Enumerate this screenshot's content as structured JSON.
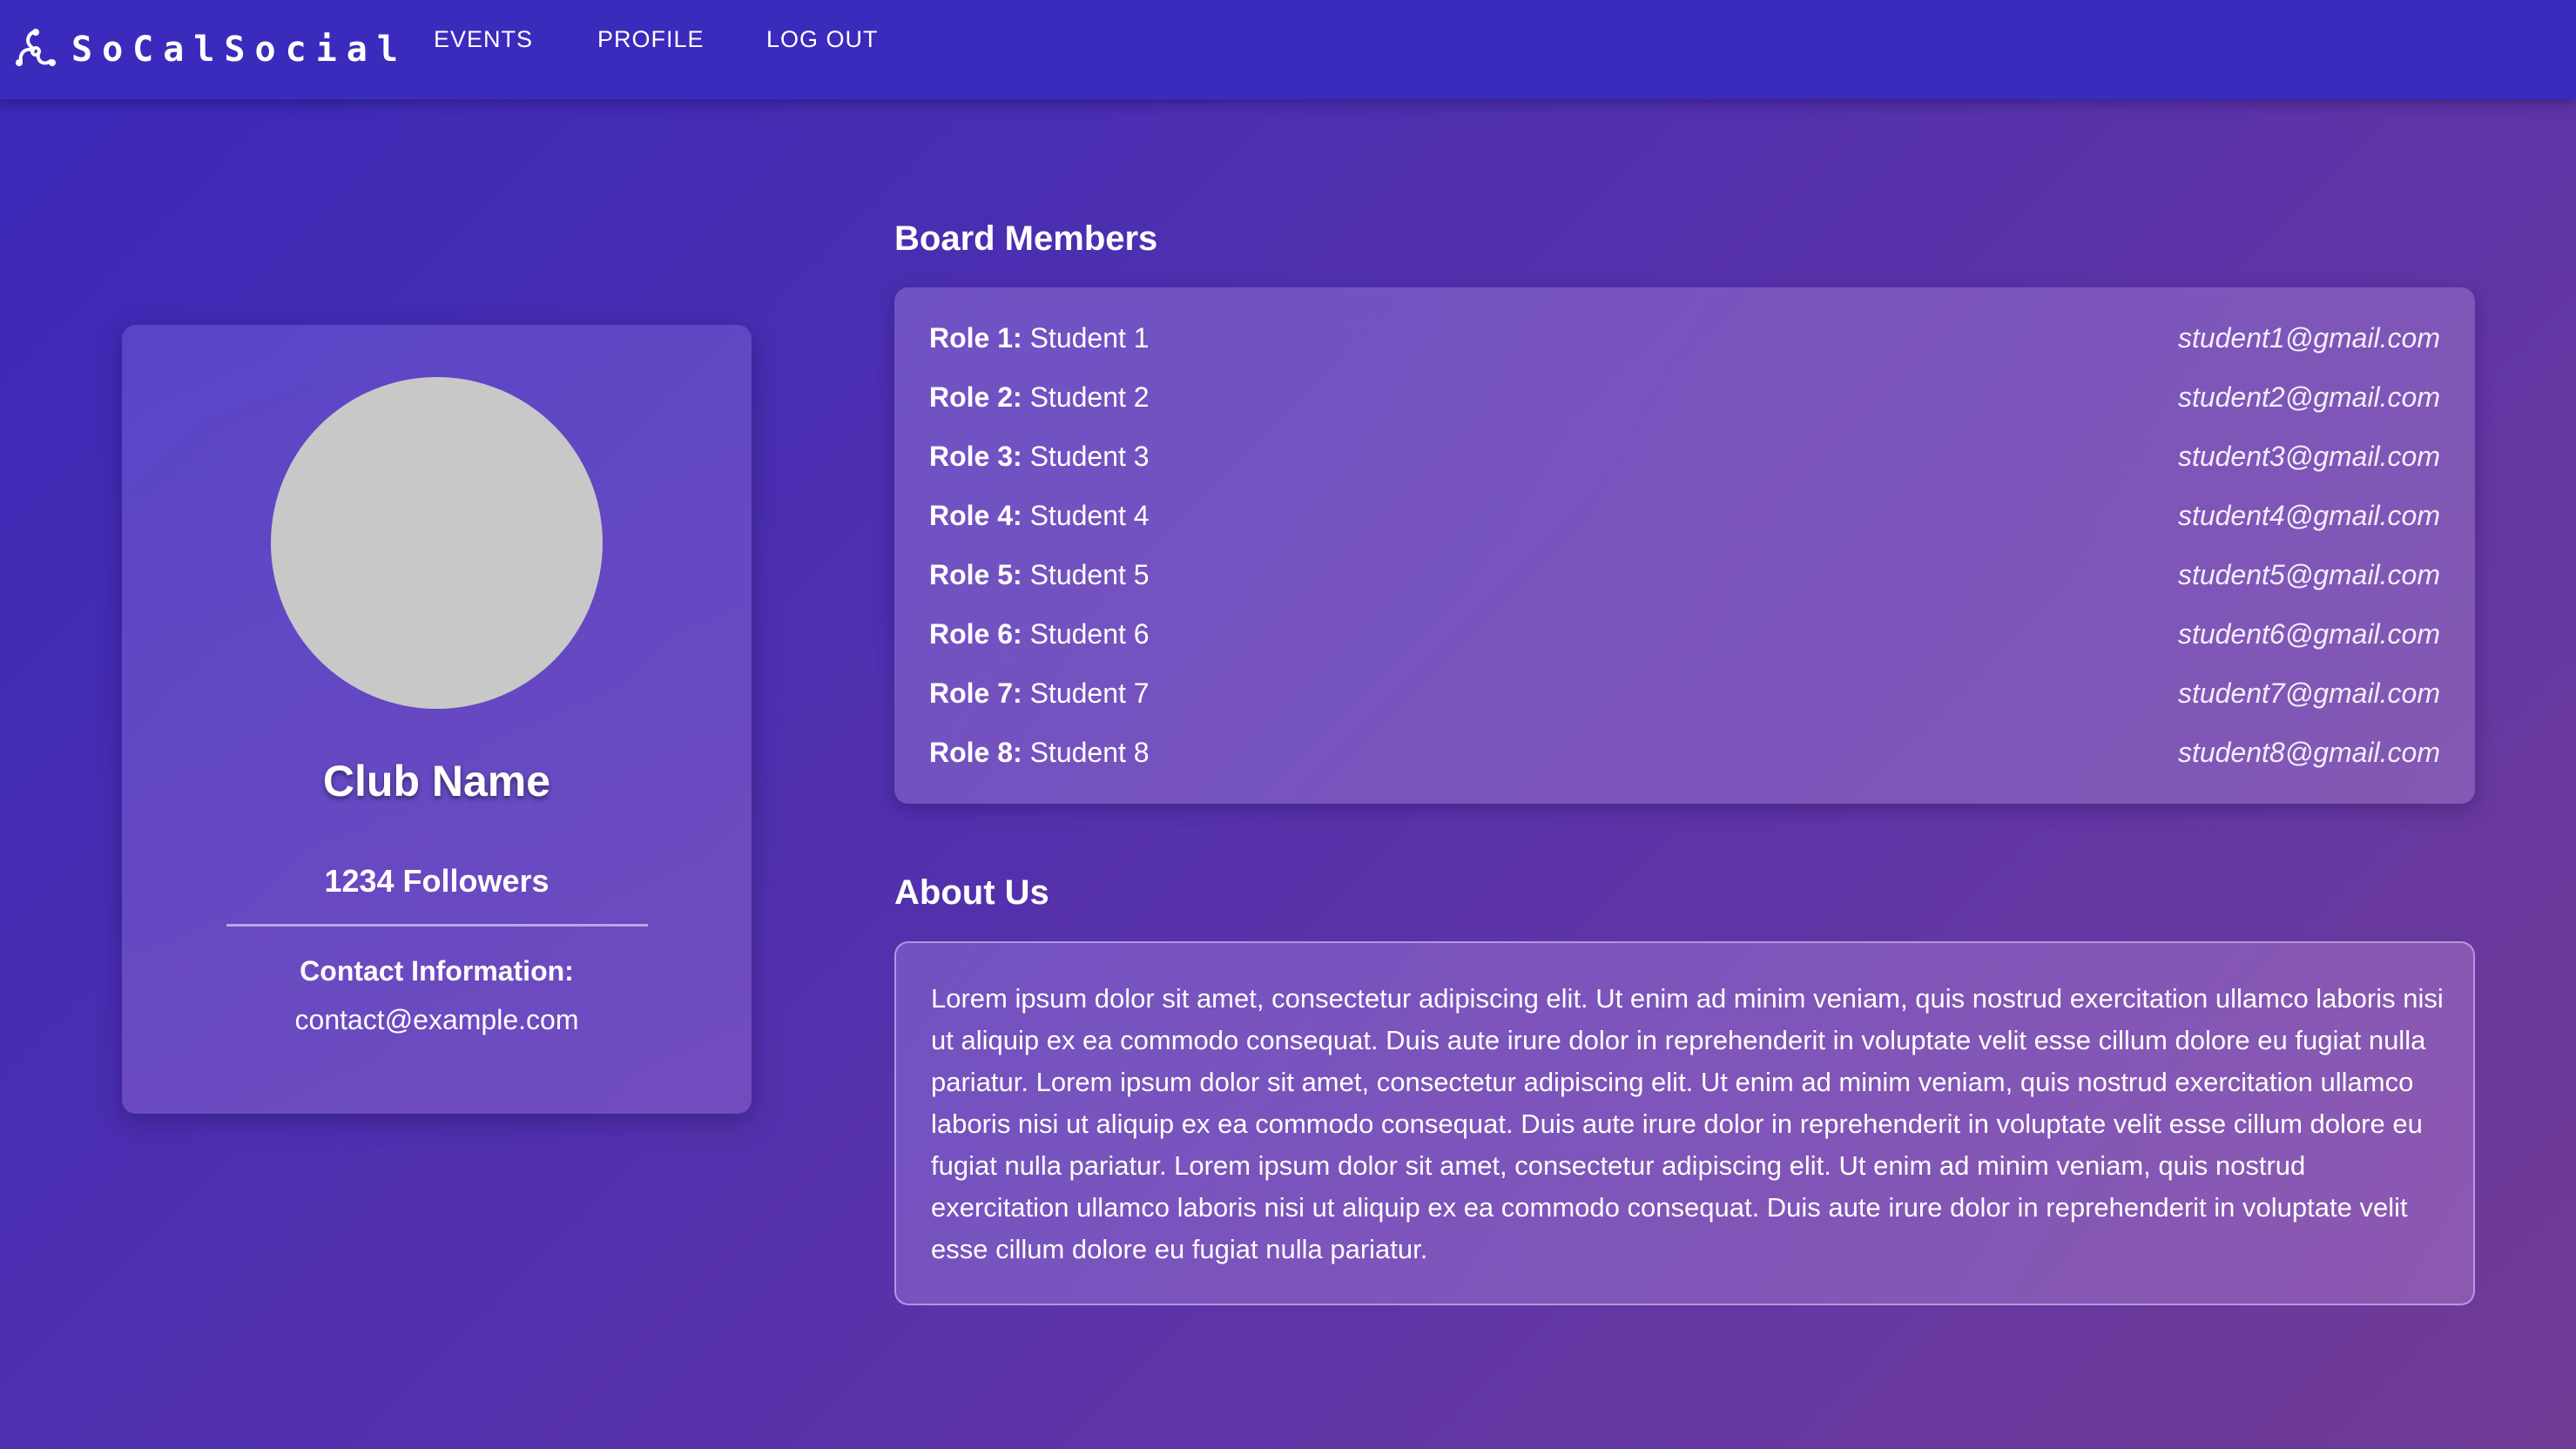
{
  "navbar": {
    "brand": "SoCalSocial",
    "brand_icon": "triskelion-logo-icon",
    "links": [
      "EVENTS",
      "PROFILE",
      "LOG OUT"
    ]
  },
  "profile": {
    "club_name": "Club Name",
    "followers": "1234 Followers",
    "contact_label": "Contact Information:",
    "contact_email": "contact@example.com"
  },
  "board": {
    "title": "Board Members",
    "members": [
      {
        "role": "Role 1:",
        "name": "Student 1",
        "email": "student1@gmail.com"
      },
      {
        "role": "Role 2:",
        "name": "Student 2",
        "email": "student2@gmail.com"
      },
      {
        "role": "Role 3:",
        "name": "Student 3",
        "email": "student3@gmail.com"
      },
      {
        "role": "Role 4:",
        "name": "Student 4",
        "email": "student4@gmail.com"
      },
      {
        "role": "Role 5:",
        "name": "Student 5",
        "email": "student5@gmail.com"
      },
      {
        "role": "Role 6:",
        "name": "Student 6",
        "email": "student6@gmail.com"
      },
      {
        "role": "Role 7:",
        "name": "Student 7",
        "email": "student7@gmail.com"
      },
      {
        "role": "Role 8:",
        "name": "Student 8",
        "email": "student8@gmail.com"
      }
    ]
  },
  "about": {
    "title": "About Us",
    "text": "Lorem ipsum dolor sit amet, consectetur adipiscing elit. Ut enim ad minim veniam, quis nostrud exercitation ullamco laboris nisi ut aliquip ex ea commodo consequat. Duis aute irure dolor in reprehenderit in voluptate velit esse cillum dolore eu fugiat nulla pariatur. Lorem ipsum dolor sit amet, consectetur adipiscing elit. Ut enim ad minim veniam, quis nostrud exercitation ullamco laboris nisi ut aliquip ex ea commodo consequat. Duis aute irure dolor in reprehenderit in voluptate velit esse cillum dolore eu fugiat nulla pariatur. Lorem ipsum dolor sit amet, consectetur adipiscing elit. Ut enim ad minim veniam, quis nostrud exercitation ullamco laboris nisi ut aliquip ex ea commodo consequat. Duis aute irure dolor in reprehenderit in voluptate velit esse cillum dolore eu fugiat nulla pariatur."
  },
  "colors": {
    "navbar": "#3a2bbd",
    "avatar_placeholder": "#c8c8c8",
    "text": "#ffffff"
  }
}
